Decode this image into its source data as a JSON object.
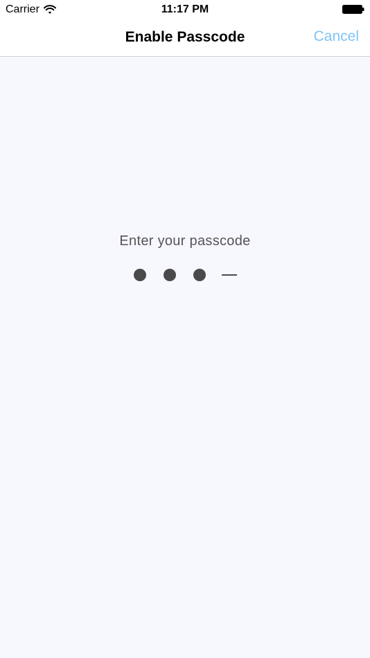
{
  "status_bar": {
    "carrier": "Carrier",
    "time": "11:17 PM",
    "wifi_icon": "wifi-icon",
    "battery_icon": "battery-icon"
  },
  "nav": {
    "title": "Enable Passcode",
    "cancel_label": "Cancel",
    "accent_color": "#7fc3f5"
  },
  "passcode": {
    "prompt": "Enter your passcode",
    "length": 4,
    "entered": 3,
    "filled_icon": "filled-dot",
    "empty_icon": "empty-dash"
  },
  "colors": {
    "background": "#f7f7fe",
    "indicator": "#4a4a4a"
  }
}
